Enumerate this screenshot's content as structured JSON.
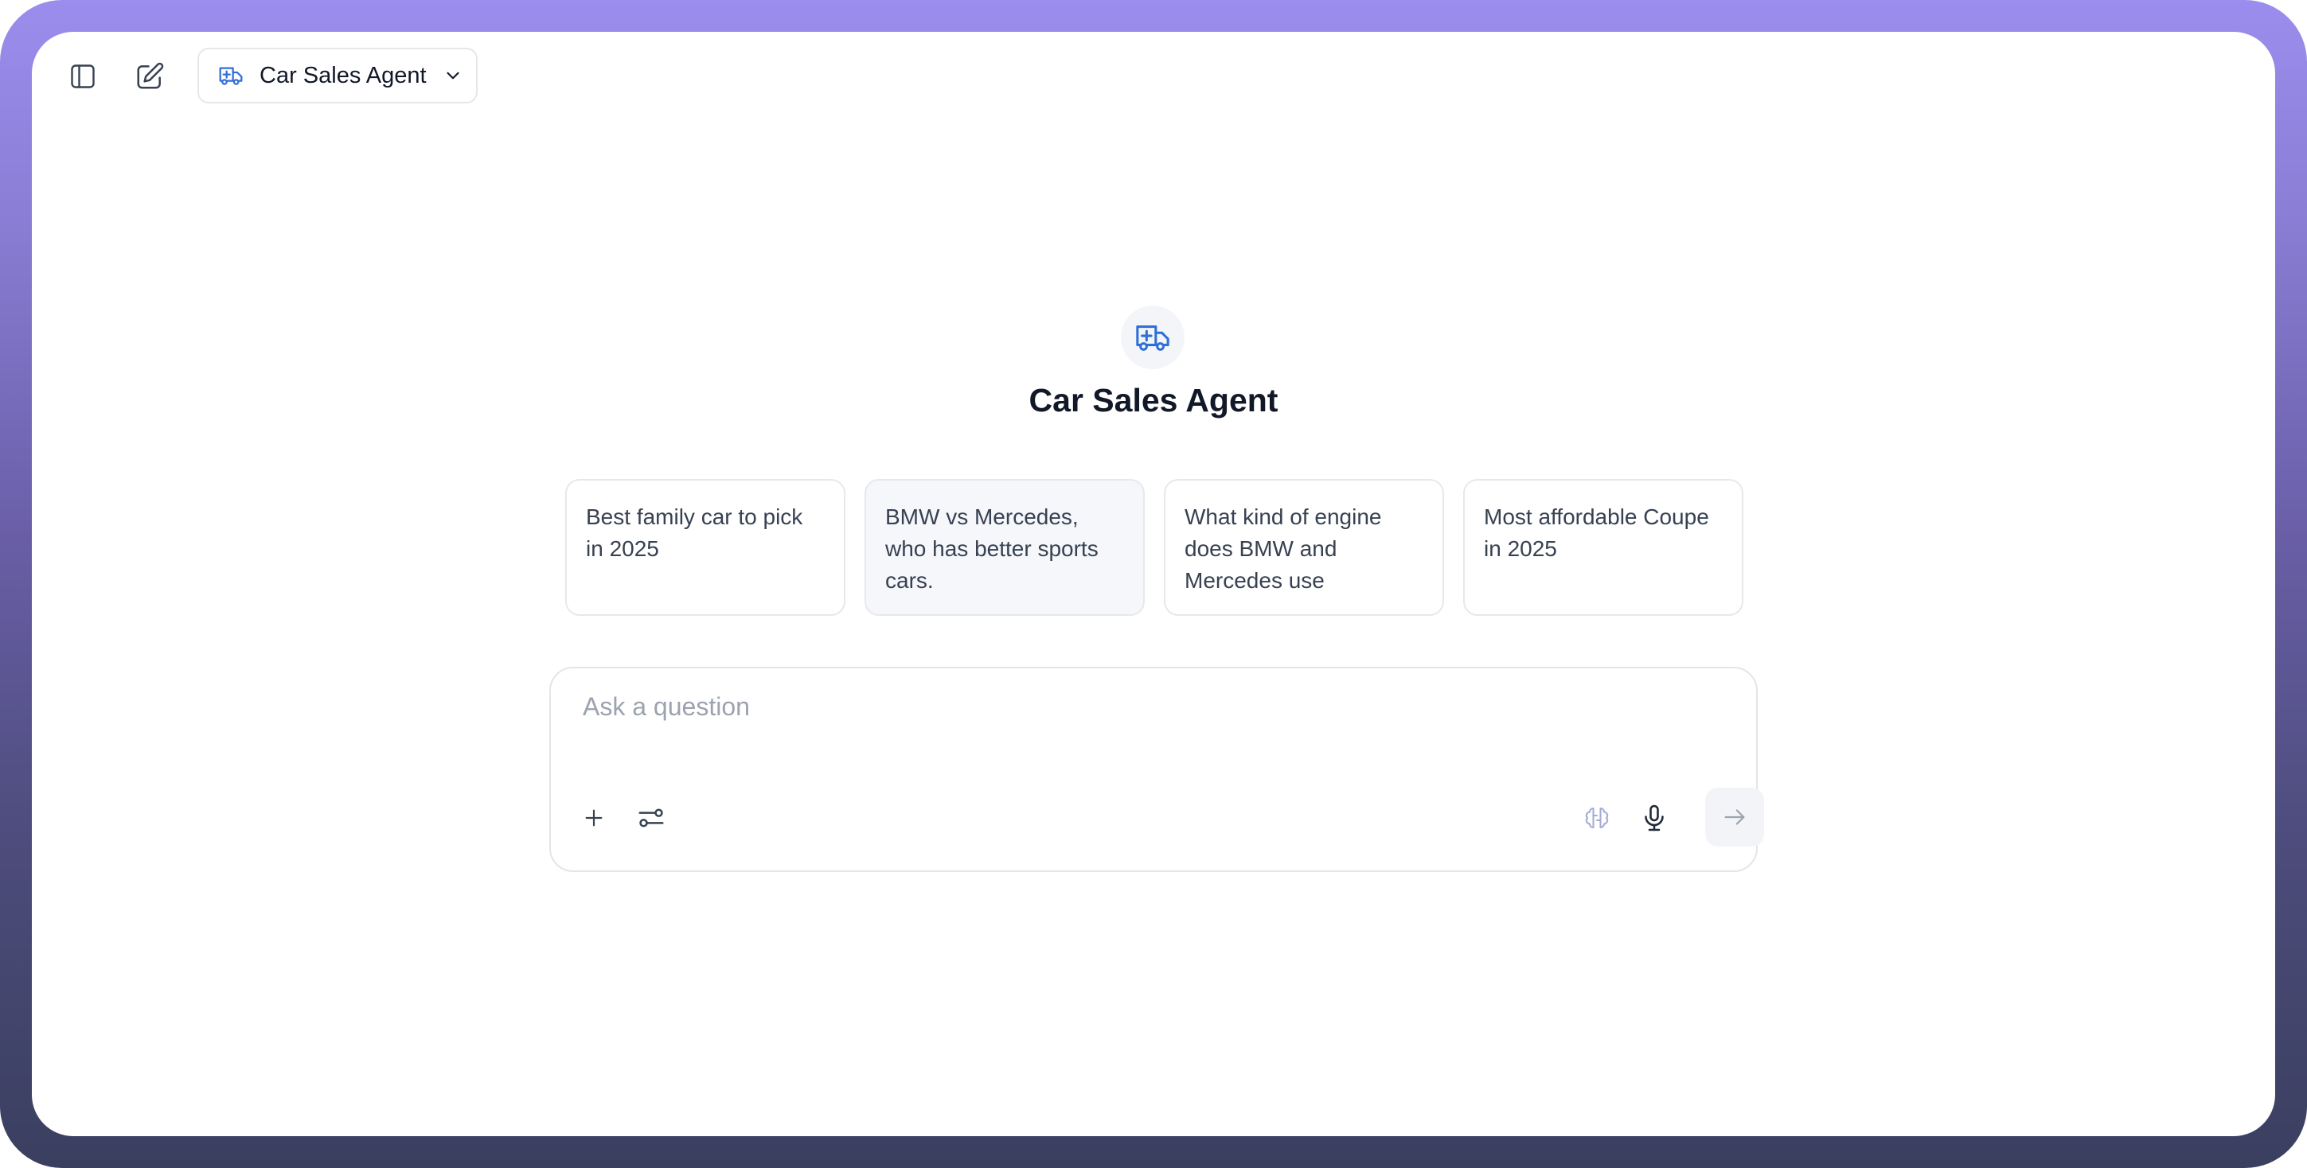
{
  "header": {
    "sidebar_toggle_icon": "sidebar-icon",
    "new_chat_icon": "edit-icon",
    "agent_selector": {
      "icon": "truck-icon",
      "label": "Car Sales Agent",
      "chevron_icon": "chevron-down-icon"
    }
  },
  "hero": {
    "icon": "truck-icon",
    "title": "Car Sales Agent"
  },
  "suggestions": [
    {
      "text": "Best family car to pick in 2025"
    },
    {
      "text": "BMW vs Mercedes, who has better sports cars."
    },
    {
      "text": "What kind of engine does BMW and Mercedes use"
    },
    {
      "text": "Most affordable Coupe in 2025"
    }
  ],
  "composer": {
    "placeholder": "Ask a question",
    "value": "",
    "attach_icon": "plus-icon",
    "tools_icon": "sliders-icon",
    "reasoning_icon": "brain-icon",
    "voice_icon": "microphone-icon",
    "send_icon": "arrow-right-icon"
  },
  "colors": {
    "accent": "#2f6fd6",
    "frame_top": "#9b8ded",
    "frame_bottom": "#3a3f5f",
    "text_primary": "#111827",
    "text_secondary": "#374151",
    "placeholder": "#9ca3af",
    "border": "#e5e7eb"
  }
}
